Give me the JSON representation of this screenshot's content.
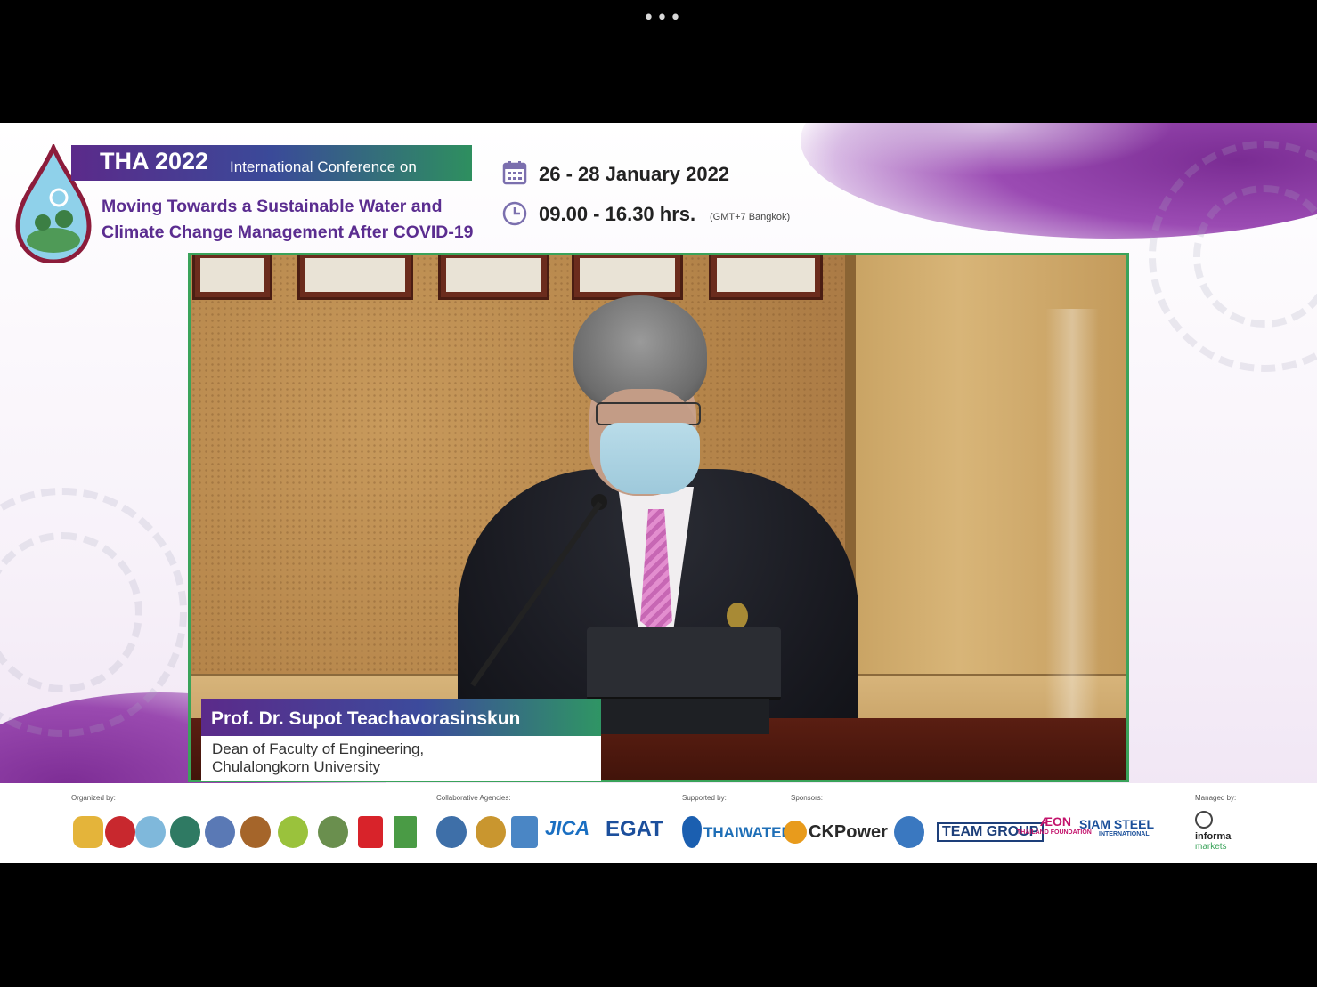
{
  "window": {
    "more_icon": "more-horizontal-icon",
    "more_glyph": "•••"
  },
  "header": {
    "conference_year": "THA 2022",
    "conference_subtitle": "International Conference on",
    "title_line1": "Moving Towards a Sustainable Water and",
    "title_line2": "Climate Change Management After COVID-19",
    "date": "26 - 28 January 2022",
    "time": "09.00 - 16.30 hrs.",
    "timezone": "(GMT+7 Bangkok)",
    "calendar_icon": "calendar-icon",
    "clock_icon": "clock-icon"
  },
  "speaker": {
    "name": "Prof. Dr. Supot Teachavorasinskun",
    "role_line1": "Dean of Faculty of Engineering,",
    "role_line2": "Chulalongkorn University"
  },
  "sponsors": {
    "organized_label": "Organized by:",
    "collaborative_label": "Collaborative Agencies:",
    "supported_label": "Supported by:",
    "sponsors_label": "Sponsors:",
    "managed_label": "Managed by:",
    "jica": "JICA",
    "egat": "EGAT",
    "thaiwater": "THAIWATER",
    "ckpower": "CKPower",
    "team_group": "TEAM GROUP",
    "aeon": "ÆON",
    "aeon_sub": "THAILAND FOUNDATION",
    "siam_steel": "SIAM STEEL",
    "siam_steel_sub": "INTERNATIONAL",
    "informa": "informa",
    "informa_sub": "markets"
  },
  "colors": {
    "brand_purple": "#5b2d90",
    "brand_green": "#2f9564",
    "video_border": "#3aa35a"
  }
}
